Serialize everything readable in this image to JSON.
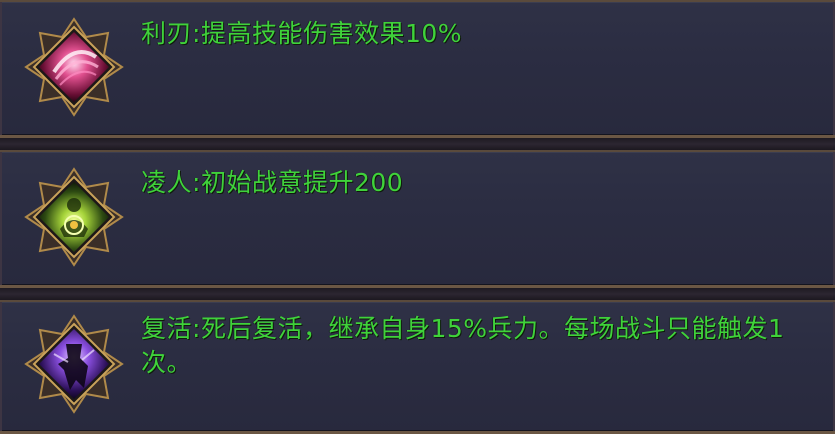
{
  "skills": [
    {
      "name": "利刃",
      "separator": ":",
      "description": "提高技能伤害效果10%",
      "icon": "blade-slash-icon",
      "icon_color": "#d0307a"
    },
    {
      "name": "凌人",
      "separator": ":",
      "description": "初始战意提升200",
      "icon": "green-aura-figure-icon",
      "icon_color": "#8bc63a"
    },
    {
      "name": "复活",
      "separator": ":",
      "description": "死后复活，继承自身15%兵力。每场战斗只能触发1次。",
      "icon": "purple-revive-silhouette-icon",
      "icon_color": "#7a3cc8"
    }
  ],
  "colors": {
    "text": "#3fd23a",
    "panel": "#2b2d42",
    "frame_gold": "#b08a4a"
  }
}
